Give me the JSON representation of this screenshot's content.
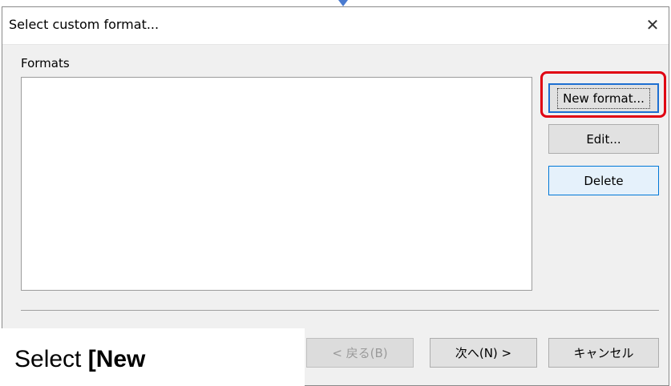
{
  "dialog": {
    "title": "Select custom format...",
    "close_glyph": "✕"
  },
  "formats": {
    "label": "Formats",
    "items": []
  },
  "buttons": {
    "new_format": "New format...",
    "edit": "Edit...",
    "delete": "Delete",
    "back": "< 戻る(B)",
    "next": "次へ(N) >",
    "cancel": "キャンセル"
  },
  "caption": {
    "prefix": "Select ",
    "bold": "[New"
  },
  "colors": {
    "highlight": "#e00012",
    "focus": "#0078d7"
  }
}
